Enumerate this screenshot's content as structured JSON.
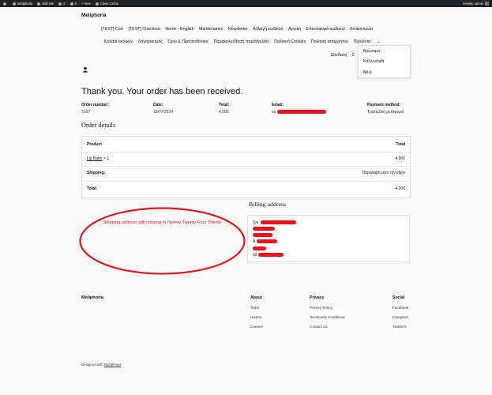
{
  "adminbar": {
    "site": "Meliphoria",
    "edit": "Edit site",
    "comments": "2",
    "notes": "0",
    "new": "New",
    "cache": "Clear Cache",
    "howdy": "Howdy, admin"
  },
  "site_title": "Meliphoria",
  "nav": {
    "row1": [
      "[TEST] Cart",
      "[TEST] Checkout",
      "Home - English",
      "Maintenance",
      "Newsletter",
      "Αλλαγή κωδικού",
      "Αρχική",
      "Επαναφορά κωδικού",
      "Επικοινωνία"
    ],
    "row2": [
      "Καλάθι αγορών",
      "Λογαριασμός",
      "Όροι & Προϋποθέσεις",
      "Παρακολούθηση παραγγελίας",
      "Πολιτική Cookies",
      "Πολιτική απορρήτου",
      "Προϊόντα"
    ],
    "row3": [
      "Σύνδεση",
      "Σ"
    ],
    "dropdown": [
      "Βρώσιμα",
      "Καλλυντικά",
      "Μέλι"
    ]
  },
  "thank_you": "Thank you. Your order has been received.",
  "overview": {
    "order_number_label": "Order number:",
    "order_number": "3107",
    "date_label": "Date:",
    "date": "18/07/2024",
    "total_label": "Total:",
    "total": "4,00€",
    "email_label": "Email:",
    "email_prefix": "es",
    "payment_label": "Payment method:",
    "payment": "Τραπεζική μεταφορά"
  },
  "order_details": {
    "heading": "Order details",
    "product_header": "Product",
    "total_header": "Total",
    "item_name": "Lip Balm",
    "item_qty": "× 1",
    "item_total": "4,00€",
    "shipping_label": "Shipping:",
    "shipping_value": "Παραλαβή από την έδρα",
    "total_label": "Total:",
    "total_value": "4,00€"
  },
  "billing": {
    "heading": "Billing address",
    "line1": "Χρι",
    "line4": "Α",
    "line6": "69"
  },
  "annotation": "Shipping address still missing in Twenty Twenty-Four Theme",
  "footer": {
    "brand": "Meliphoria",
    "about": {
      "heading": "About",
      "links": [
        "Team",
        "History",
        "Careers"
      ]
    },
    "privacy": {
      "heading": "Privacy",
      "links": [
        "Privacy Policy",
        "Terms and Conditions",
        "Contact Us"
      ]
    },
    "social": {
      "heading": "Social",
      "links": [
        "Facebook",
        "Instagram",
        "Twitter/X"
      ]
    },
    "designed_prefix": "Designed with ",
    "designed_link": "WordPress"
  },
  "colors": {
    "annotation_red": "#e8141c",
    "adminbar": "#1d2327"
  }
}
